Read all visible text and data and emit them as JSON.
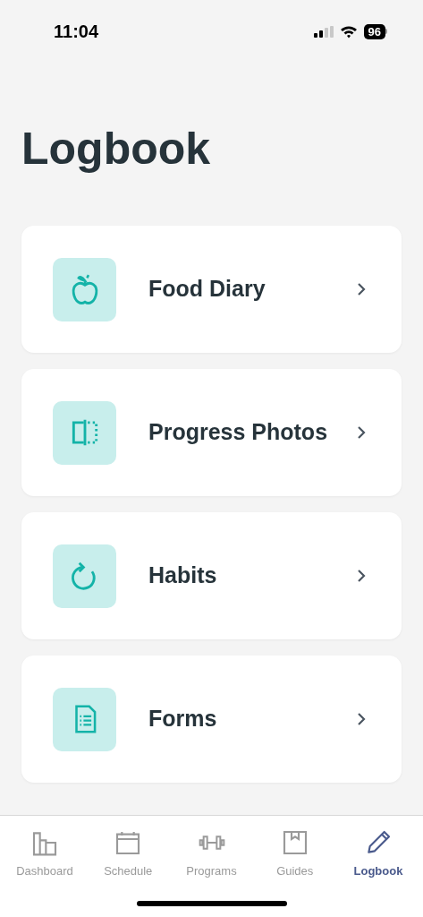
{
  "status_bar": {
    "time": "11:04",
    "battery": "96"
  },
  "title": "Logbook",
  "items": [
    {
      "kind": "apple",
      "label": "Food Diary"
    },
    {
      "kind": "split",
      "label": "Progress Photos"
    },
    {
      "kind": "refresh",
      "label": "Habits"
    },
    {
      "kind": "document",
      "label": "Forms"
    }
  ],
  "tab_bar": [
    {
      "kind": "dashboard",
      "label": "Dashboard",
      "selected": false
    },
    {
      "kind": "calendar",
      "label": "Schedule",
      "selected": false
    },
    {
      "kind": "dumbbell",
      "label": "Programs",
      "selected": false
    },
    {
      "kind": "guide",
      "label": "Guides",
      "selected": false
    },
    {
      "kind": "pencil",
      "label": "Logbook",
      "selected": true
    }
  ]
}
